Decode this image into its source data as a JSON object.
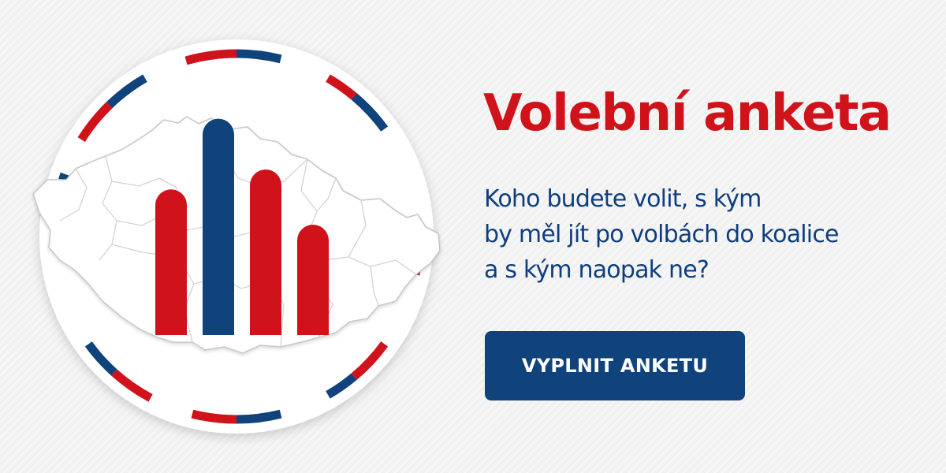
{
  "headline": "Volební anketa",
  "subtitle": {
    "lines": [
      "Koho budete volit, s kým",
      "by měl jít po volbách do koalice",
      "a s kým naopak ne?"
    ]
  },
  "cta": {
    "label": "VYPLNIT ANKETU"
  },
  "colors": {
    "red": "#d0121b",
    "blue": "#10427c",
    "background": "#f1f1f1"
  },
  "emblem": {
    "map_icon": "czech-republic-map",
    "bars": [
      {
        "color": "red",
        "level": 0.66
      },
      {
        "color": "blue",
        "level": 0.98
      },
      {
        "color": "red",
        "level": 0.75
      },
      {
        "color": "red",
        "level": 0.5
      }
    ]
  }
}
